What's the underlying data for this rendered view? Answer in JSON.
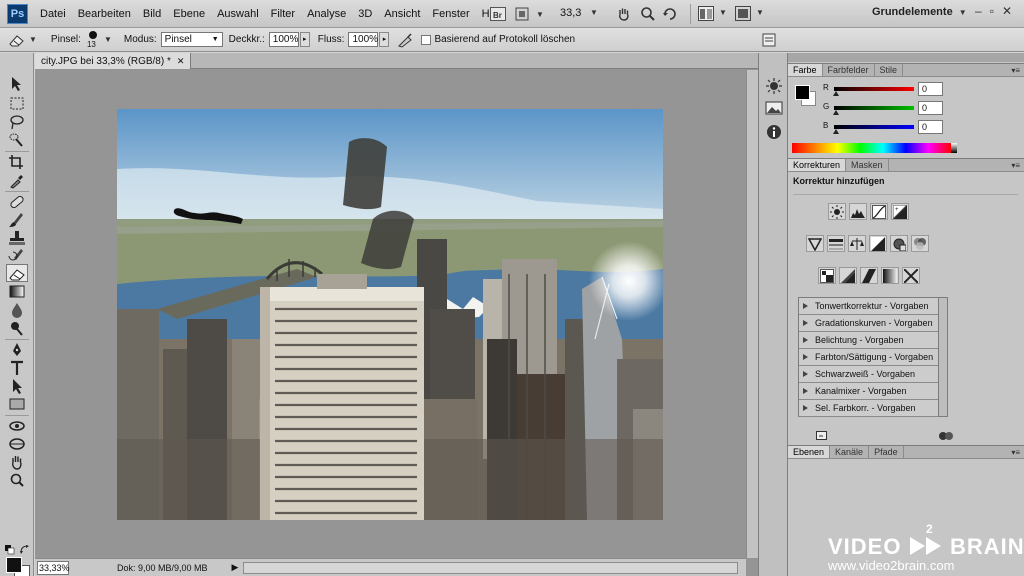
{
  "menubar": {
    "logo": "Ps",
    "items": [
      "Datei",
      "Bearbeiten",
      "Bild",
      "Ebene",
      "Auswahl",
      "Filter",
      "Analyse",
      "3D",
      "Ansicht",
      "Fenster",
      "Hilfe"
    ],
    "zoom": "33,3",
    "workspace": "Grundelemente"
  },
  "options": {
    "brush_label": "Pinsel:",
    "brush_size": "13",
    "mode_label": "Modus:",
    "mode_value": "Pinsel",
    "opacity_label": "Deckkr.:",
    "opacity_value": "100%",
    "flow_label": "Fluss:",
    "flow_value": "100%",
    "history_label": "Basierend auf Protokoll löschen"
  },
  "document": {
    "tab_title": "city.JPG bei 33,3% (RGB/8) *",
    "status_zoom": "33,33%",
    "doc_info": "Dok: 9,00 MB/9,00 MB"
  },
  "color_panel": {
    "tabs": [
      "Farbe",
      "Farbfelder",
      "Stile"
    ],
    "channels": [
      {
        "label": "R",
        "value": "0",
        "color": "#ff0000"
      },
      {
        "label": "G",
        "value": "0",
        "color": "#00c000"
      },
      {
        "label": "B",
        "value": "0",
        "color": "#0000ff"
      }
    ]
  },
  "adjustments": {
    "tabs": [
      "Korrekturen",
      "Masken"
    ],
    "title": "Korrektur hinzufügen",
    "presets": [
      "Tonwertkorrektur - Vorgaben",
      "Gradationskurven - Vorgaben",
      "Belichtung - Vorgaben",
      "Farbton/Sättigung - Vorgaben",
      "Schwarzweiß - Vorgaben",
      "Kanalmixer - Vorgaben",
      "Sel. Farbkorr. - Vorgaben"
    ]
  },
  "layers_panel": {
    "tabs": [
      "Ebenen",
      "Kanäle",
      "Pfade"
    ]
  },
  "watermark": {
    "left": "VIDEO",
    "sup": "2",
    "right": "BRAIN",
    "url": "www.video2brain.com"
  }
}
